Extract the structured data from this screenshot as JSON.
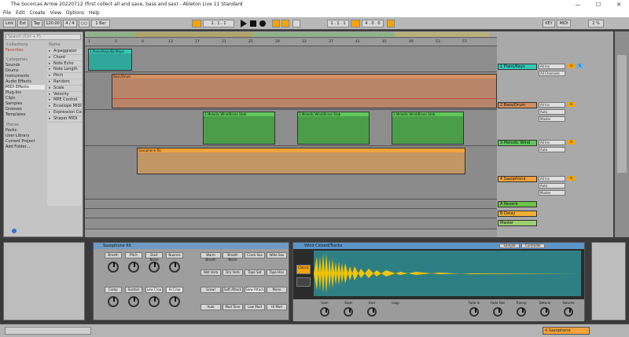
{
  "window": {
    "title": "The Socorcas Arrow 20220712 (first collect all and save, bass and sax) - Ableton Live 11 Standard",
    "minimize": "—",
    "maximize": "☐",
    "close": "✕"
  },
  "menu": [
    "File",
    "Edit",
    "Create",
    "View",
    "Options",
    "Help"
  ],
  "control_bar": {
    "link": "Link",
    "ext": "Ext",
    "tap": "Tap",
    "tempo": "120.00",
    "time_sig": "4 / 4",
    "metro": "○○",
    "quant": "1 Bar",
    "position": "1 . 1 . 1",
    "loop_start": "1 . 1 . 1",
    "loop_len": "4 . 0 . 0",
    "key": "KEY",
    "midi": "MIDI",
    "cpu": "2 %"
  },
  "browser": {
    "search_placeholder": "Search (Ctrl + F)",
    "collections_label": "Collections",
    "favorites": "Favorites",
    "categories_label": "Categories",
    "categories": [
      "Sounds",
      "Drums",
      "Instruments",
      "Audio Effects",
      "MIDI Effects",
      "Plug-Ins",
      "Clips",
      "Samples",
      "Grooves",
      "Templates"
    ],
    "places_label": "Places",
    "places": [
      "Packs",
      "User Library",
      "Current Project",
      "Add Folder..."
    ],
    "name_header": "Name",
    "files": [
      "Arpeggiator",
      "Chord",
      "Note Echo",
      "Note Length",
      "Pitch",
      "Random",
      "Scale",
      "Velocity",
      "MPE Control",
      "Envelope MIDI",
      "Expression Control",
      "Shaper MIDI"
    ]
  },
  "ruler": [
    "1",
    "5",
    "9",
    "13",
    "17",
    "21",
    "25",
    "29",
    "33",
    "37",
    "41",
    "45",
    "49",
    "53",
    "57"
  ],
  "tracks": [
    {
      "name": "1 Piano/Keys",
      "color": "#35c8b8",
      "clips": [
        "1 Piano/Keys/Eb Major"
      ]
    },
    {
      "name": "2 Bass/Drum",
      "color": "#d4905e",
      "clips": [
        "Bass/Drum"
      ]
    },
    {
      "name": "3 Melodic Wind",
      "color": "#5ec85a",
      "clips": [
        "3 Melodic Wind/Brass Stab",
        "3 Melodic Wind/Brass Stab",
        "3 Melodic Wind/Brass Stab"
      ]
    },
    {
      "name": "4 Saxophone",
      "color": "#f5a33c",
      "clips": [
        "Saxophone Ric"
      ]
    },
    {
      "name": "A Reverb",
      "color": "#6ec24a"
    },
    {
      "name": "B Delay",
      "color": "#f1b035"
    },
    {
      "name": "Master",
      "color": "#9bd06e"
    }
  ],
  "mixer_io": {
    "midi_from": "All Ins",
    "channel": "All Channels",
    "monitor": "Auto",
    "audio_to": "Master",
    "volume": "0",
    "sends": "S"
  },
  "rack": {
    "name": "Saxophone Kit",
    "macros": [
      "Breath",
      "Pitch",
      "Dust Noise",
      "Nuance",
      "Comp",
      "Sustain",
      "Low Crop",
      "Hi Crop"
    ],
    "chain_buttons": [
      "Warm Breath",
      "Breath Noise",
      "Crack Sax",
      "Wide Sax",
      "Wet Verb",
      "Dry Verb",
      "Tape Sat",
      "Tape Hiss",
      "Growl",
      "Soft Attack",
      "Slow Attack",
      "Mono",
      "Auto",
      "Mod Tone",
      "Low Mod",
      "Hi Mod"
    ]
  },
  "sampler": {
    "name": "Wind Closed/Tracks",
    "sample_btn": "Sample",
    "controls_btn": "Controller",
    "mode": "Classic",
    "volume_label": "Volume",
    "transpose_label": "Transp",
    "detune_label": "Detune",
    "start_label": "Start",
    "end_label": "End",
    "fade_in_label": "Fade In",
    "fade_out_label": "Fade Out",
    "loop_label": "Loop",
    "gain_label": "Gain"
  },
  "status": {
    "track_name": "4 Saxophone"
  },
  "colors": {
    "accent": "#f5a400",
    "teal": "#35c8b8",
    "orange_clip": "#d4905e",
    "green_clip": "#5ec85a",
    "sax_clip": "#f5a33c",
    "waveform": "#f5c400"
  }
}
